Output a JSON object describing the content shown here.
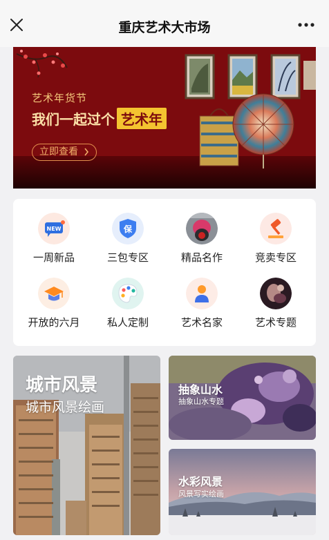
{
  "navbar": {
    "title": "重庆艺术大市场",
    "close_icon": "close-icon",
    "more_icon": "more-dots-icon"
  },
  "banner": {
    "subtitle": "艺术年货节",
    "title_prefix": "我们一起过个",
    "title_highlight": "艺术年",
    "button_label": "立即查看",
    "colors": {
      "background": "#7c0b0e",
      "gold": "#f4c430"
    }
  },
  "categories": [
    {
      "label": "一周新品",
      "icon": "new-badge-icon"
    },
    {
      "label": "三包专区",
      "icon": "shield-guarantee-icon"
    },
    {
      "label": "精品名作",
      "icon": "masterpiece-thumbnail-icon"
    },
    {
      "label": "竞卖专区",
      "icon": "auction-gavel-icon"
    },
    {
      "label": "开放的六月",
      "icon": "graduation-cap-icon"
    },
    {
      "label": "私人定制",
      "icon": "palette-icon"
    },
    {
      "label": "艺术名家",
      "icon": "artist-person-icon"
    },
    {
      "label": "艺术专题",
      "icon": "art-topic-thumbnail-icon"
    }
  ],
  "tiles": [
    {
      "title": "城市风景",
      "subtitle": "城市风景绘画"
    },
    {
      "title": "抽象山水",
      "subtitle": "抽象山水专题"
    },
    {
      "title": "水彩风景",
      "subtitle": "风景写实绘画"
    }
  ]
}
